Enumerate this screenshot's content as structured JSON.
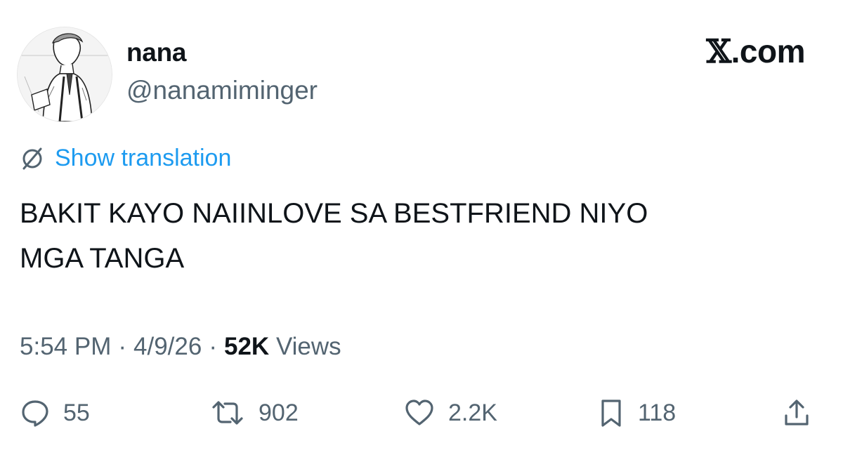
{
  "author": {
    "display_name": "nana",
    "handle": "@nanamiminger"
  },
  "brand": {
    "logo_letter": "𝕏",
    "domain": ".com"
  },
  "translate": {
    "label": "Show translation"
  },
  "tweet": {
    "text": "BAKIT KAYO NAIINLOVE SA BESTFRIEND NIYO\nMGA TANGA"
  },
  "meta": {
    "time": "5:54 PM",
    "separator": "·",
    "date": "4/9/26",
    "views_count": "52K",
    "views_label": "Views"
  },
  "actions": {
    "replies": "55",
    "reposts": "902",
    "likes": "2.2K",
    "bookmarks": "118"
  },
  "icons": {
    "translate": "globe-slash-icon",
    "reply": "speech-bubble-icon",
    "repost": "repost-arrows-icon",
    "like": "heart-icon",
    "bookmark": "bookmark-icon",
    "share": "share-upload-icon"
  },
  "colors": {
    "link": "#1d9bf0",
    "muted": "#536471",
    "text": "#0f1419"
  }
}
